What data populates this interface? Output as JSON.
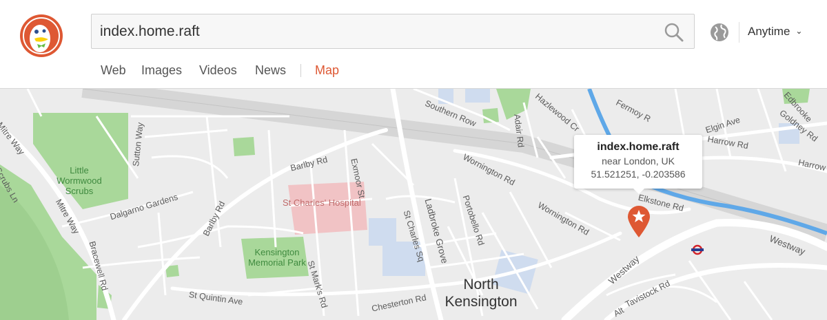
{
  "search": {
    "value": "index.home.raft",
    "placeholder": ""
  },
  "header": {
    "time_filter": "Anytime"
  },
  "tabs": [
    {
      "label": "Web"
    },
    {
      "label": "Images"
    },
    {
      "label": "Videos"
    },
    {
      "label": "News"
    },
    {
      "label": "Map"
    }
  ],
  "popup": {
    "title": "index.home.raft",
    "location": "near London, UK",
    "coords": "51.521251, -0.203586"
  },
  "map": {
    "streets": [
      "Mitre Way",
      "Scrubs Ln",
      "Sutton Way",
      "Barlby Rd",
      "Exmoor St",
      "Dalgarno Gardens",
      "Barlby Rd",
      "Mitre Way",
      "Bracewell Rd",
      "St Mark's Rd",
      "St Quintin Ave",
      "Ladbroke Grove",
      "St Charles Sq",
      "Portobello Rd",
      "Chesterton Rd",
      "Wornington Rd",
      "Wornington Rd",
      "Southern Row",
      "Hazlewood Cr",
      "Adair Rd",
      "Elgin Ave",
      "Harrow Rd",
      "Harrow Rd",
      "Fermoy R",
      "Edbrooke",
      "Goldney Rd",
      "Elkstone Rd",
      "Westway",
      "Westway",
      "Tavistock Rd",
      "Alt"
    ],
    "parks": [
      "Little Wormwood Scrubs",
      "Kensington Memorial Park"
    ],
    "hospital": "St Charles' Hospital",
    "area": "North Kensington"
  },
  "colors": {
    "accent": "#de5833",
    "park": "#a9d89a",
    "water": "#5fa8e8",
    "map_bg": "#ececec"
  }
}
